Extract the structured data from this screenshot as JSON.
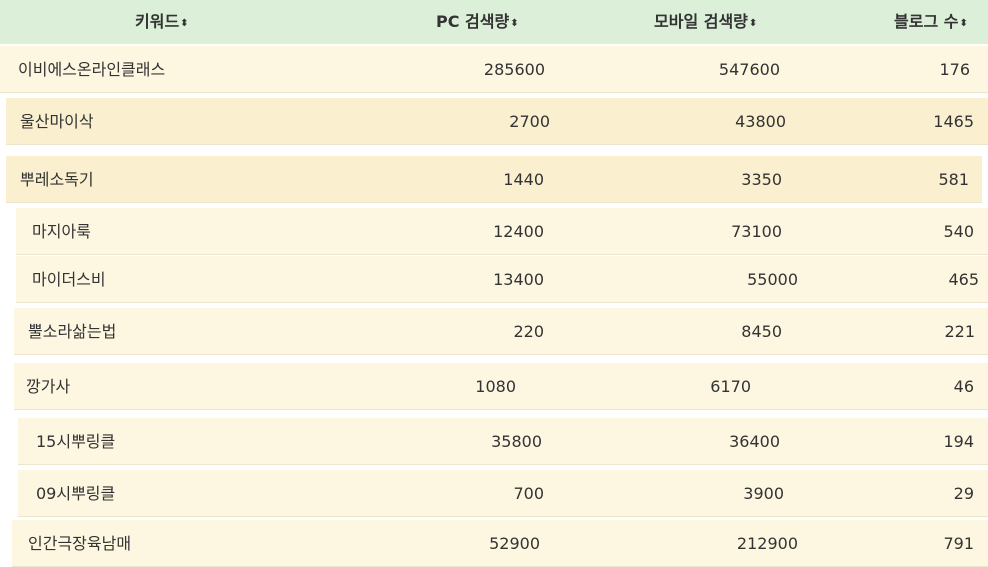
{
  "header": {
    "keyword": "키워드",
    "pc": "PC 검색량",
    "mobile": "모바일 검색량",
    "blog": "블로그 수",
    "sort_icon": "⬍"
  },
  "rows": [
    {
      "keyword": "이비에스온라인클래스",
      "pc": "285600",
      "mobile": "547600",
      "blog": "176"
    },
    {
      "keyword": "울산마이삭",
      "pc": "2700",
      "mobile": "43800",
      "blog": "1465"
    },
    {
      "keyword": "뿌레소독기",
      "pc": "1440",
      "mobile": "3350",
      "blog": "581"
    },
    {
      "keyword": "마지아룩",
      "pc": "12400",
      "mobile": "73100",
      "blog": "540"
    },
    {
      "keyword": "마이더스비",
      "pc": "13400",
      "mobile": "55000",
      "blog": "465"
    },
    {
      "keyword": "뿔소라삶는법",
      "pc": "220",
      "mobile": "8450",
      "blog": "221"
    },
    {
      "keyword": "깡가사",
      "pc": "1080",
      "mobile": "6170",
      "blog": "46"
    },
    {
      "keyword": "15시뿌링클",
      "pc": "35800",
      "mobile": "36400",
      "blog": "194"
    },
    {
      "keyword": "09시뿌링클",
      "pc": "700",
      "mobile": "3900",
      "blog": "29"
    },
    {
      "keyword": "인간극장육남매",
      "pc": "52900",
      "mobile": "212900",
      "blog": "791"
    }
  ],
  "colors": {
    "header_bg": "#dcefd9",
    "row_bg_light": "#fdf7e1",
    "row_bg_dark": "#faf0cf",
    "text": "#333333"
  }
}
